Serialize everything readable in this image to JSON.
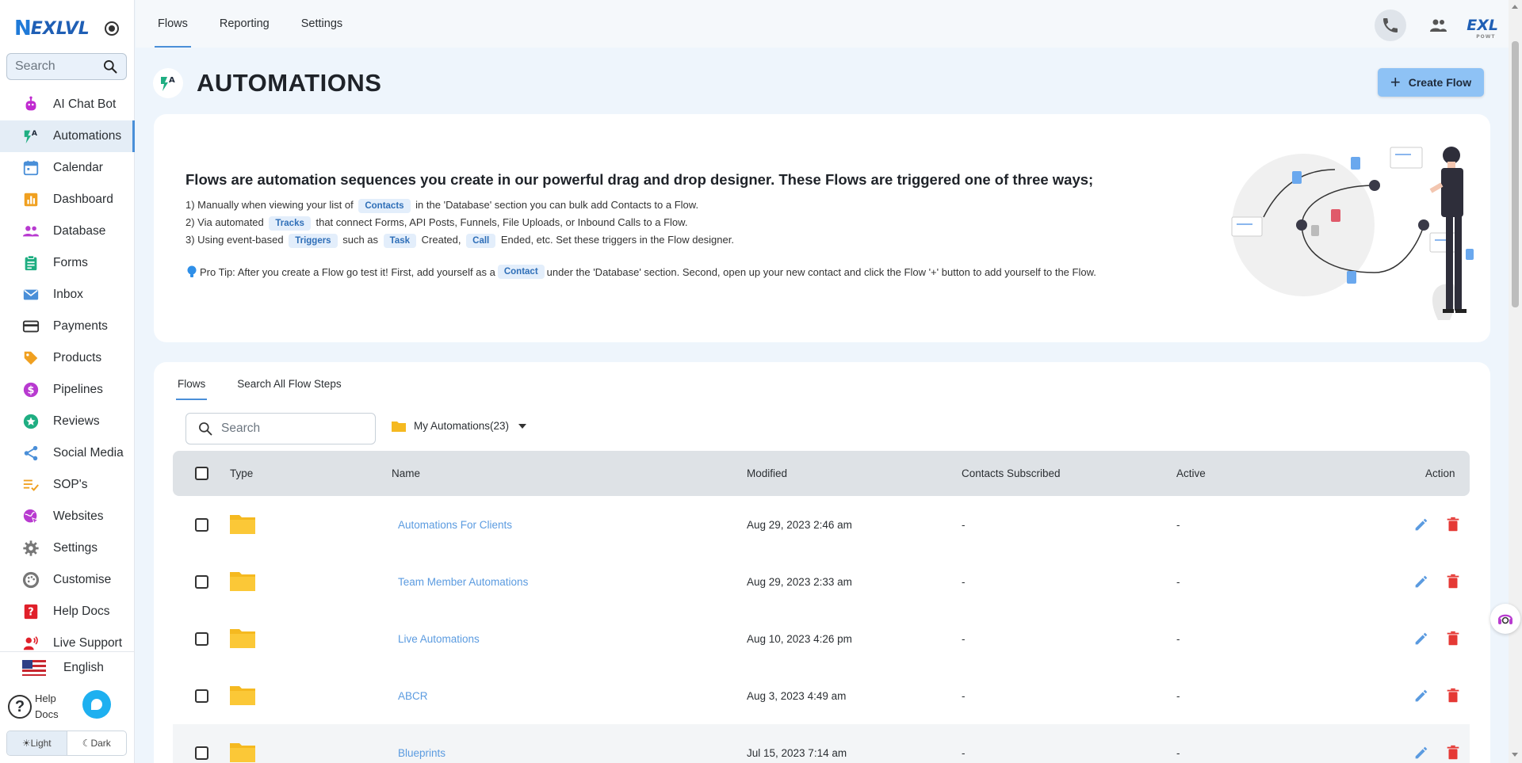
{
  "brand": {
    "logo_text": "EXLVL",
    "logo_letter": "N",
    "mini": "EXL",
    "mini_sub": "POWT"
  },
  "sidebar": {
    "search_placeholder": "Search",
    "items": [
      {
        "label": "AI Chat Bot",
        "icon": "robot-icon",
        "color": "#c02ad0"
      },
      {
        "label": "Automations",
        "icon": "automation-bolt-icon",
        "color": "#1fae82",
        "active": true
      },
      {
        "label": "Calendar",
        "icon": "calendar-icon",
        "color": "#4a8fd8"
      },
      {
        "label": "Dashboard",
        "icon": "bar-chart-icon",
        "color": "#f0a020"
      },
      {
        "label": "Database",
        "icon": "people-icon",
        "color": "#b83ad0"
      },
      {
        "label": "Forms",
        "icon": "clipboard-icon",
        "color": "#1fae82"
      },
      {
        "label": "Inbox",
        "icon": "mail-icon",
        "color": "#4a8fd8"
      },
      {
        "label": "Payments",
        "icon": "credit-card-icon",
        "color": "#333333"
      },
      {
        "label": "Products",
        "icon": "tag-icon",
        "color": "#f0a020"
      },
      {
        "label": "Pipelines",
        "icon": "dollar-circle-icon",
        "color": "#b83ad0"
      },
      {
        "label": "Reviews",
        "icon": "star-circle-icon",
        "color": "#1fae82"
      },
      {
        "label": "Social Media",
        "icon": "share-icon",
        "color": "#4a8fd8"
      },
      {
        "label": "SOP's",
        "icon": "checklist-icon",
        "color": "#f0a020"
      },
      {
        "label": "Websites",
        "icon": "globe-cursor-icon",
        "color": "#b83ad0"
      },
      {
        "label": "Settings",
        "icon": "gear-icon",
        "color": "#777777"
      },
      {
        "label": "Customise",
        "icon": "palette-icon",
        "color": "#777777"
      },
      {
        "label": "Help Docs",
        "icon": "help-doc-icon",
        "color": "#e0202a"
      },
      {
        "label": "Live Support",
        "icon": "live-support-icon",
        "color": "#e0202a"
      }
    ],
    "language": "English",
    "help_line1": "Help",
    "help_line2": "Docs",
    "theme_light": "Light",
    "theme_dark": "Dark"
  },
  "topbar": {
    "tabs": [
      {
        "label": "Flows",
        "active": true
      },
      {
        "label": "Reporting"
      },
      {
        "label": "Settings"
      }
    ]
  },
  "header": {
    "title": "AUTOMATIONS",
    "create_label": "Create Flow"
  },
  "intro": {
    "heading": "Flows are automation sequences you create in our powerful drag and drop designer. These Flows are triggered one of three ways;",
    "line1": {
      "before": "1) Manually when viewing your list of",
      "chip": "Contacts",
      "after": "in the 'Database' section you can bulk add Contacts to a Flow."
    },
    "line2": {
      "before": "2) Via automated",
      "chip": "Tracks",
      "after": "that connect Forms, API Posts, Funnels, File Uploads, or Inbound Calls to a Flow."
    },
    "line3": {
      "before": "3) Using event-based",
      "chip1": "Triggers",
      "mid1": "such as",
      "chip2": "Task",
      "mid2": "Created,",
      "chip3": "Call",
      "after": "Ended, etc. Set these triggers in the Flow designer."
    },
    "tip": {
      "before": "Pro Tip: After you create a Flow go test it! First, add yourself as a",
      "chip": "Contact",
      "after": "under the 'Database' section. Second, open up your new contact and click the Flow '+' button to add yourself to the Flow."
    }
  },
  "flows": {
    "tabs": [
      {
        "label": "Flows",
        "active": true
      },
      {
        "label": "Search All Flow Steps"
      }
    ],
    "search_placeholder": "Search",
    "folder_select": "My Automations(23)",
    "columns": {
      "type": "Type",
      "name": "Name",
      "modified": "Modified",
      "contacts": "Contacts Subscribed",
      "active": "Active",
      "action": "Action"
    },
    "rows": [
      {
        "name": "Automations For Clients",
        "modified": "Aug 29, 2023 2:46 am",
        "contacts": "-",
        "active": "-"
      },
      {
        "name": "Team Member Automations",
        "modified": "Aug 29, 2023 2:33 am",
        "contacts": "-",
        "active": "-"
      },
      {
        "name": "Live Automations",
        "modified": "Aug 10, 2023 4:26 pm",
        "contacts": "-",
        "active": "-"
      },
      {
        "name": "ABCR",
        "modified": "Aug 3, 2023 4:49 am",
        "contacts": "-",
        "active": "-"
      },
      {
        "name": "Blueprints",
        "modified": "Jul 15, 2023 7:14 am",
        "contacts": "-",
        "active": "-"
      }
    ]
  },
  "colors": {
    "accent": "#4a8fd8",
    "create_button": "#8ec2f5",
    "folder": "#f5b920",
    "delete": "#e53935",
    "edit": "#5b9be0"
  }
}
